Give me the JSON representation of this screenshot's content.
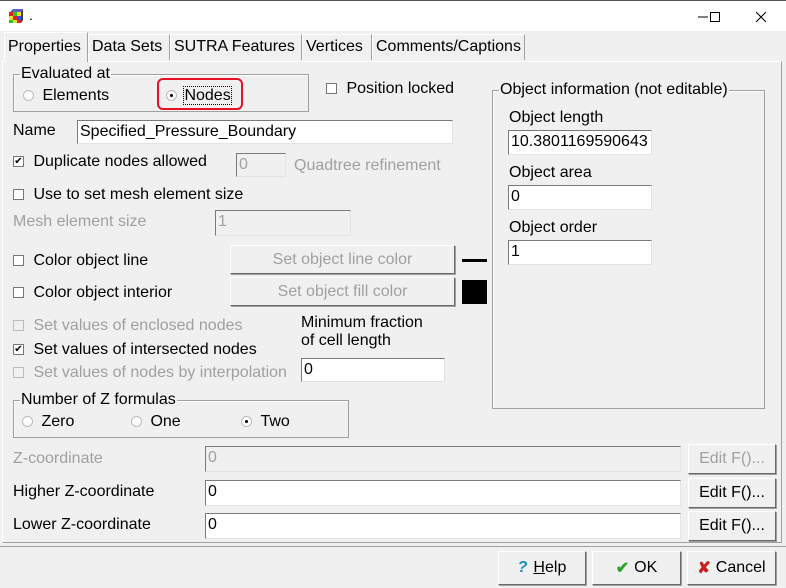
{
  "window": {
    "title": ".",
    "app_icon": "modelmuse-cube-icon",
    "minimize": "—",
    "maximize": "☐",
    "close": "✕"
  },
  "tabs": [
    {
      "label": "Properties",
      "active": true
    },
    {
      "label": "Data Sets",
      "active": false
    },
    {
      "label": "SUTRA Features",
      "active": false
    },
    {
      "label": "Vertices",
      "active": false
    },
    {
      "label": "Comments/Captions",
      "active": false
    }
  ],
  "evaluated_at": {
    "legend": "Evaluated at",
    "options": [
      {
        "label": "Elements",
        "selected": false
      },
      {
        "label": "Nodes",
        "selected": true
      }
    ]
  },
  "position_locked": {
    "label": "Position locked",
    "checked": false
  },
  "name": {
    "label": "Name",
    "value": "Specified_Pressure_Boundary"
  },
  "duplicate_nodes": {
    "label": "Duplicate nodes allowed",
    "checked": true
  },
  "quadtree": {
    "value": "0",
    "label": "Quadtree refinement"
  },
  "mesh_size_check": {
    "label": "Use to set mesh element size",
    "checked": false
  },
  "mesh_element_size": {
    "label": "Mesh element size",
    "value": "1"
  },
  "color_line": {
    "label": "Color object line",
    "checked": false,
    "button": "Set object line color",
    "swatch": "#000000"
  },
  "color_interior": {
    "label": "Color object interior",
    "checked": false,
    "button": "Set object fill color",
    "swatch": "#000000"
  },
  "set_enclosed": {
    "label": "Set values of enclosed nodes",
    "checked": false,
    "enabled": false
  },
  "set_intersected": {
    "label": "Set values of intersected nodes",
    "checked": true,
    "enabled": true
  },
  "set_interpolation": {
    "label": "Set values of nodes by interpolation",
    "checked": false,
    "enabled": false
  },
  "min_fraction": {
    "label_line1": "Minimum fraction",
    "label_line2": "of cell length",
    "value": "0"
  },
  "z_formulas": {
    "legend": "Number of Z formulas",
    "options": [
      {
        "label": "Zero",
        "selected": false
      },
      {
        "label": "One",
        "selected": false
      },
      {
        "label": "Two",
        "selected": true
      }
    ]
  },
  "object_info": {
    "legend": "Object information (not editable)",
    "length_label": "Object length",
    "length_value": "10.3801169590643",
    "area_label": "Object area",
    "area_value": "0",
    "order_label": "Object order",
    "order_value": "1"
  },
  "z_coordinate": {
    "label": "Z-coordinate",
    "value": "0",
    "button": "Edit F()...",
    "enabled": false
  },
  "higher_z": {
    "label": "Higher Z-coordinate",
    "value": "0",
    "button": "Edit F()..."
  },
  "lower_z": {
    "label": "Lower Z-coordinate",
    "value": "0",
    "button": "Edit F()..."
  },
  "buttons": {
    "help": "Help",
    "ok": "OK",
    "cancel": "Cancel"
  },
  "colors": {
    "highlight": "#e81123",
    "ok_check": "#2aa52a",
    "cancel_x": "#c62020",
    "help_icon": "#1a8fc0"
  }
}
